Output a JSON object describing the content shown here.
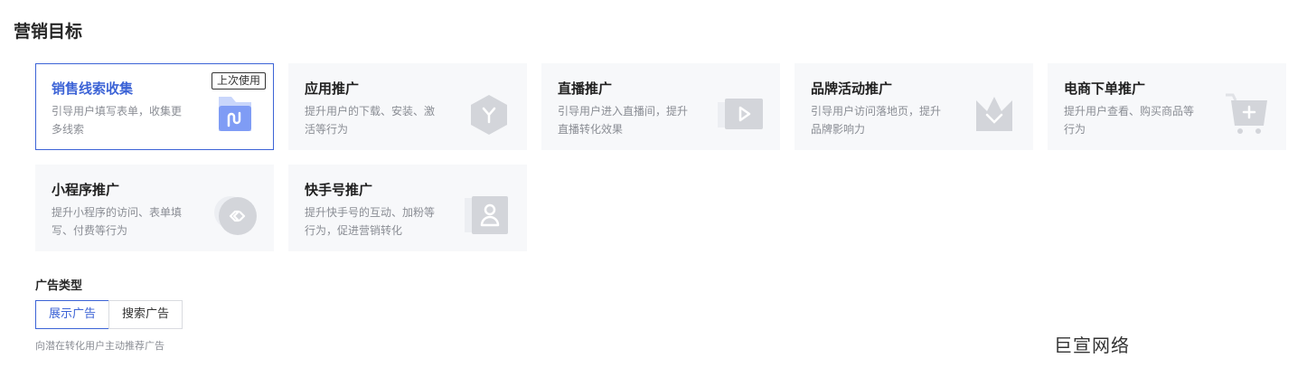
{
  "section_title": "营销目标",
  "cards": [
    {
      "title": "销售线索收集",
      "desc": "引导用户填写表单，收集更多线索",
      "badge": "上次使用",
      "icon": "folder-icon",
      "selected": true
    },
    {
      "title": "应用推广",
      "desc": "提升用户的下载、安装、激活等行为",
      "icon": "app-hexagon-icon"
    },
    {
      "title": "直播推广",
      "desc": "引导用户进入直播间，提升直播转化效果",
      "icon": "video-play-icon"
    },
    {
      "title": "品牌活动推广",
      "desc": "引导用户访问落地页，提升品牌影响力",
      "icon": "crown-icon"
    },
    {
      "title": "电商下单推广",
      "desc": "提升用户查看、购买商品等行为",
      "icon": "shopping-cart-icon"
    },
    {
      "title": "小程序推广",
      "desc": "提升小程序的访问、表单填写、付费等行为",
      "icon": "mini-program-icon"
    },
    {
      "title": "快手号推广",
      "desc": "提升快手号的互动、加粉等行为，促进营销转化",
      "icon": "user-profile-icon"
    }
  ],
  "ad_type": {
    "label": "广告类型",
    "options": [
      "展示广告",
      "搜索广告"
    ],
    "selected": "展示广告",
    "hint": "向潜在转化用户主动推荐广告"
  },
  "watermark": "巨宣网络",
  "colors": {
    "accent": "#3c63d6",
    "card_bg": "#f7f8fa",
    "muted_text": "#8a8d94"
  }
}
